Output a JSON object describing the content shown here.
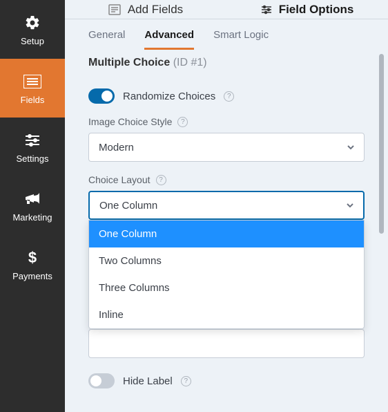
{
  "sidebar": {
    "items": [
      {
        "label": "Setup"
      },
      {
        "label": "Fields"
      },
      {
        "label": "Settings"
      },
      {
        "label": "Marketing"
      },
      {
        "label": "Payments"
      }
    ]
  },
  "tabs_top": {
    "add_fields": "Add Fields",
    "field_options": "Field Options"
  },
  "subtabs": {
    "general": "General",
    "advanced": "Advanced",
    "smart_logic": "Smart Logic"
  },
  "section": {
    "title": "Multiple Choice",
    "id_text": "(ID #1)"
  },
  "randomize": {
    "label": "Randomize Choices"
  },
  "image_choice_style": {
    "label": "Image Choice Style",
    "value": "Modern"
  },
  "choice_layout": {
    "label": "Choice Layout",
    "value": "One Column",
    "options": [
      "One Column",
      "Two Columns",
      "Three Columns",
      "Inline"
    ]
  },
  "hide_label": {
    "label": "Hide Label"
  }
}
